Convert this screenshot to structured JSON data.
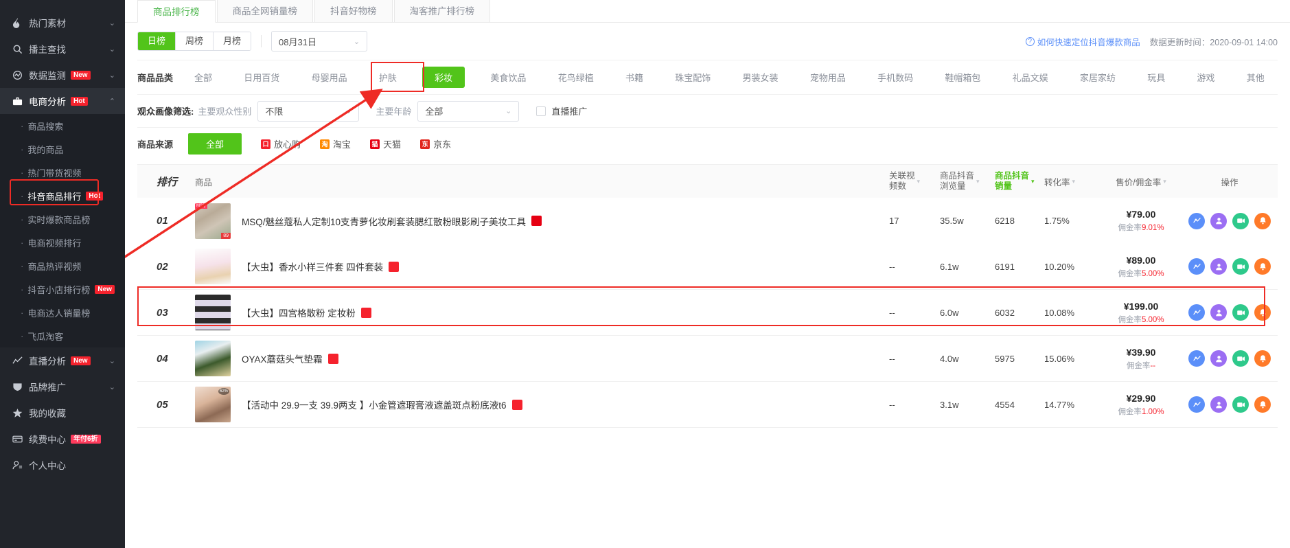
{
  "sidebar": {
    "items": [
      {
        "label": "热门素材",
        "icon": "fire-icon",
        "chevron": "⌄",
        "badge": null
      },
      {
        "label": "播主查找",
        "icon": "search-icon",
        "chevron": "⌄",
        "badge": null
      },
      {
        "label": "数据监测",
        "icon": "monitor-icon",
        "chevron": "⌄",
        "badge": "New"
      },
      {
        "label": "电商分析",
        "icon": "briefcase-icon",
        "chevron": "⌃",
        "badge": "Hot"
      }
    ],
    "subitems": [
      {
        "label": "商品搜索",
        "badge": null
      },
      {
        "label": "我的商品",
        "badge": null
      },
      {
        "label": "热门带货视频",
        "badge": null
      },
      {
        "label": "抖音商品排行",
        "badge": "Hot"
      },
      {
        "label": "实时爆款商品榜",
        "badge": null
      },
      {
        "label": "电商视频排行",
        "badge": null
      },
      {
        "label": "商品热评视频",
        "badge": null
      },
      {
        "label": "抖音小店排行榜",
        "badge": "New"
      },
      {
        "label": "电商达人销量榜",
        "badge": null
      },
      {
        "label": "飞瓜淘客",
        "badge": null
      }
    ],
    "items_bottom": [
      {
        "label": "直播分析",
        "icon": "chart-line-icon",
        "chevron": "⌄",
        "badge": "New"
      },
      {
        "label": "品牌推广",
        "icon": "shield-icon",
        "chevron": "⌄",
        "badge": null
      },
      {
        "label": "我的收藏",
        "icon": "star-icon",
        "chevron": "",
        "badge": null
      },
      {
        "label": "续费中心",
        "icon": "card-icon",
        "chevron": "",
        "badge": "年付6折"
      },
      {
        "label": "个人中心",
        "icon": "user-icon",
        "chevron": "",
        "badge": null
      }
    ]
  },
  "tabs": [
    {
      "label": "商品排行榜",
      "active": true
    },
    {
      "label": "商品全网销量榜",
      "active": false
    },
    {
      "label": "抖音好物榜",
      "active": false
    },
    {
      "label": "淘客推广排行榜",
      "active": false
    }
  ],
  "period": {
    "options": [
      "日榜",
      "周榜",
      "月榜"
    ],
    "selected": "日榜",
    "date_value": "08月31日",
    "date_caret": "⌄"
  },
  "help": {
    "question_mark": "?",
    "link_label": "如何快速定位抖音爆款商品",
    "update_label": "数据更新时间：2020-09-01 14:00"
  },
  "category": {
    "label": "商品品类",
    "items": [
      "全部",
      "日用百货",
      "母婴用品",
      "护肤",
      "彩妆",
      "美食饮品",
      "花鸟绿植",
      "书籍",
      "珠宝配饰",
      "男装女装",
      "宠物用品",
      "手机数码",
      "鞋帽箱包",
      "礼品文娱",
      "家居家纺",
      "玩具",
      "游戏",
      "其他"
    ],
    "selected": "彩妆"
  },
  "audience": {
    "label": "观众画像筛选:",
    "gender_label": "主要观众性别",
    "gender_value": "不限",
    "age_label": "主要年龄",
    "age_value": "全部",
    "caret": "⌄",
    "live_promo_label": "直播推广",
    "live_promo_checked": false
  },
  "source": {
    "label": "商品来源",
    "all_label": "全部",
    "items": [
      {
        "label": "放心购",
        "icon_text": "口",
        "color": "#f5222d"
      },
      {
        "label": "淘宝",
        "icon_text": "淘",
        "color": "#ff8a00"
      },
      {
        "label": "天猫",
        "icon_text": "猫",
        "color": "#e60012"
      },
      {
        "label": "京东",
        "icon_text": "东",
        "color": "#e1251b"
      }
    ]
  },
  "table": {
    "headers": [
      {
        "label": "排行",
        "sortable": false,
        "highlight": false
      },
      {
        "label": "商品",
        "sortable": false,
        "highlight": false
      },
      {
        "label": "关联视\n频数",
        "sortable": true,
        "highlight": false
      },
      {
        "label": "商品抖音\n浏览量",
        "sortable": true,
        "highlight": false
      },
      {
        "label": "商品抖音\n销量",
        "sortable": true,
        "highlight": true
      },
      {
        "label": "转化率",
        "sortable": true,
        "highlight": false
      },
      {
        "label": "售价/佣金率",
        "sortable": true,
        "highlight": false
      },
      {
        "label": "操作",
        "sortable": false,
        "highlight": false
      }
    ],
    "header_parts": {
      "h1_a": "关联视",
      "h1_b": "频数",
      "h2_a": "商品抖音",
      "h2_b": "浏览量",
      "h3_a": "商品抖音",
      "h3_b": "销量",
      "h4": "转化率",
      "h5": "售价/佣金率",
      "h6": "操作",
      "rank": "排行",
      "product": "商品",
      "sort_glyph": "▾"
    },
    "rows": [
      {
        "rank": "01",
        "name": "MSQ/魅丝蔻私人定制10支青萝化妆刷套装腮红散粉眼影刷子美妆工具",
        "shop_icon": "天猫",
        "shop_color": "#e60012",
        "video_count": "17",
        "views": "35.5w",
        "sales": "6218",
        "conversion": "1.75%",
        "price": "¥79.00",
        "commission_label": "佣金率",
        "commission_value": "9.01%",
        "thumb_corner": "MSQ",
        "thumb_price": "89",
        "highlighted": true
      },
      {
        "rank": "02",
        "name": "【大虫】香水小样三件套 四件套装",
        "shop_icon": "口",
        "shop_color": "#f5222d",
        "video_count": "--",
        "views": "6.1w",
        "sales": "6191",
        "conversion": "10.20%",
        "price": "¥89.00",
        "commission_label": "佣金率",
        "commission_value": "5.00%",
        "thumb_corner": "",
        "thumb_price": "",
        "highlighted": false
      },
      {
        "rank": "03",
        "name": "【大虫】四宫格散粉 定妆粉",
        "shop_icon": "口",
        "shop_color": "#f5222d",
        "video_count": "--",
        "views": "6.0w",
        "sales": "6032",
        "conversion": "10.08%",
        "price": "¥199.00",
        "commission_label": "佣金率",
        "commission_value": "5.00%",
        "thumb_corner": "",
        "thumb_price": "",
        "highlighted": false
      },
      {
        "rank": "04",
        "name": "OYAX蘑菇头气垫霜",
        "shop_icon": "口",
        "shop_color": "#f5222d",
        "video_count": "--",
        "views": "4.0w",
        "sales": "5975",
        "conversion": "15.06%",
        "price": "¥39.90",
        "commission_label": "佣金率",
        "commission_value": "--",
        "thumb_corner": "",
        "thumb_price": "",
        "highlighted": false
      },
      {
        "rank": "05",
        "name": "【活动中 29.9一支 39.9两支 】小金管遮瑕膏液遮盖斑点粉底液t6",
        "shop_icon": "口",
        "shop_color": "#f5222d",
        "video_count": "--",
        "views": "3.1w",
        "sales": "4554",
        "conversion": "14.77%",
        "price": "¥29.90",
        "commission_label": "佣金率",
        "commission_value": "1.00%",
        "thumb_corner": "62%",
        "thumb_price": "",
        "highlighted": false
      }
    ],
    "ops": [
      {
        "name": "trend-chart-icon",
        "color": "#5b8ff9",
        "glyph": "📈"
      },
      {
        "name": "author-icon",
        "color": "#9b6ef3",
        "glyph": "●"
      },
      {
        "name": "video-play-icon",
        "color": "#2ec98b",
        "glyph": "▶"
      },
      {
        "name": "alert-bell-icon",
        "color": "#ff7a29",
        "glyph": "♞"
      }
    ]
  },
  "colors": {
    "accent_green": "#52c41a",
    "highlight_red": "#ee2b25",
    "sidebar_bg": "#22252b",
    "link_blue": "#5b8ff9"
  }
}
